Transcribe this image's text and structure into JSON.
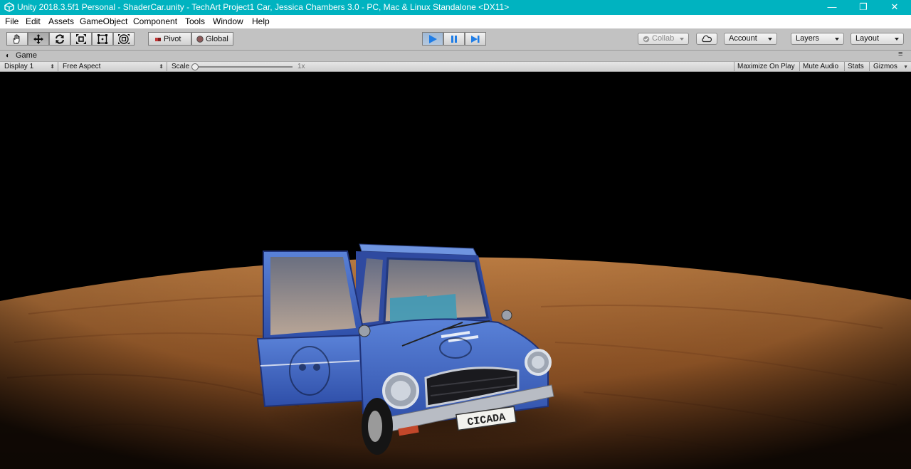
{
  "window": {
    "title": "Unity 2018.3.5f1 Personal - ShaderCar.unity - TechArt Project1 Car, Jessica Chambers 3.0 - PC, Mac & Linux Standalone <DX11>",
    "minimize": "—",
    "maximize": "❐",
    "close": "✕",
    "bar_color": "#00b3c0"
  },
  "menu": [
    "File",
    "Edit",
    "Assets",
    "GameObject",
    "Component",
    "Tools",
    "Window",
    "Help"
  ],
  "toolbar": {
    "tools": [
      "hand-tool-icon",
      "move-tool-icon",
      "rotate-tool-icon",
      "scale-tool-icon",
      "rect-tool-icon",
      "transform-tool-icon"
    ],
    "pivot_label": "Pivot",
    "global_label": "Global",
    "collab_label": "Collab",
    "account_label": "Account",
    "layers_label": "Layers",
    "layout_label": "Layout",
    "play_color": "#3c8ee8"
  },
  "game_tab": {
    "label": "Game",
    "display": "Display 1",
    "aspect": "Free Aspect",
    "scale_label": "Scale",
    "scale_value": "1x",
    "maximize_on_play": "Maximize On Play",
    "mute_audio": "Mute Audio",
    "stats": "Stats",
    "gizmos": "Gizmos"
  },
  "scene": {
    "license_plate": "CICADA",
    "car_color": "#3a5fbf",
    "floor_color": "#b36a32"
  }
}
